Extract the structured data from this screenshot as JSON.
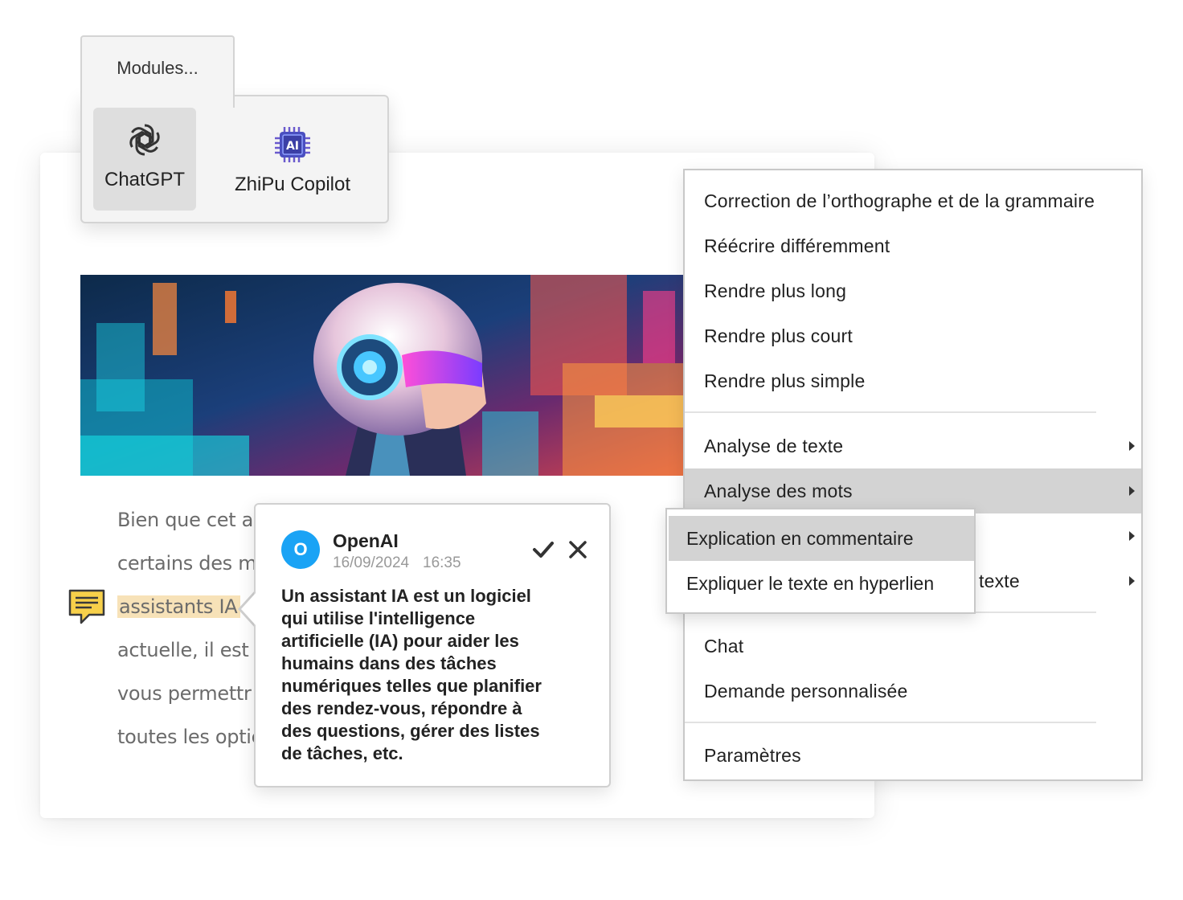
{
  "modules": {
    "tab_label": "Modules...",
    "items": [
      {
        "label": "ChatGPT",
        "icon": "openai-icon",
        "selected": true
      },
      {
        "label": "ZhiPu Copilot",
        "icon": "ai-chip-icon",
        "selected": false
      }
    ]
  },
  "document": {
    "banner_image": "robot-helmet-illustration",
    "lines": [
      "Bien que cet ar",
      "certains des m",
      "assistants IA",
      "actuelle, il est c",
      "vous permettr",
      "toutes les optic"
    ],
    "highlight_color": "#f7e2b8"
  },
  "context_menu": {
    "groups": [
      [
        "Correction de l’orthographe et de la grammaire",
        "Réécrire différemment",
        "Rendre plus long",
        "Rendre plus court",
        "Rendre plus simple"
      ],
      [
        "Analyse de texte",
        "Analyse des mots",
        "",
        "texte"
      ],
      [
        "Chat",
        "Demande personnalisée"
      ],
      [
        "Paramètres"
      ]
    ],
    "active_item": "Analyse des mots"
  },
  "submenu": {
    "items": [
      "Explication en commentaire",
      "Expliquer le texte en hyperlien"
    ],
    "active_item": "Explication en commentaire"
  },
  "comment": {
    "avatar_letter": "O",
    "avatar_color": "#1aa3f5",
    "author": "OpenAI",
    "date": "16/09/2024",
    "time": "16:35",
    "body_lines": [
      "Un assistant IA est un logiciel",
      "qui utilise l'intelligence",
      "artificielle (IA) pour aider les",
      "humains dans des tâches",
      "numériques telles que planifier",
      "des rendez-vous, répondre à",
      "des questions, gérer des listes",
      "de tâches, etc."
    ]
  }
}
